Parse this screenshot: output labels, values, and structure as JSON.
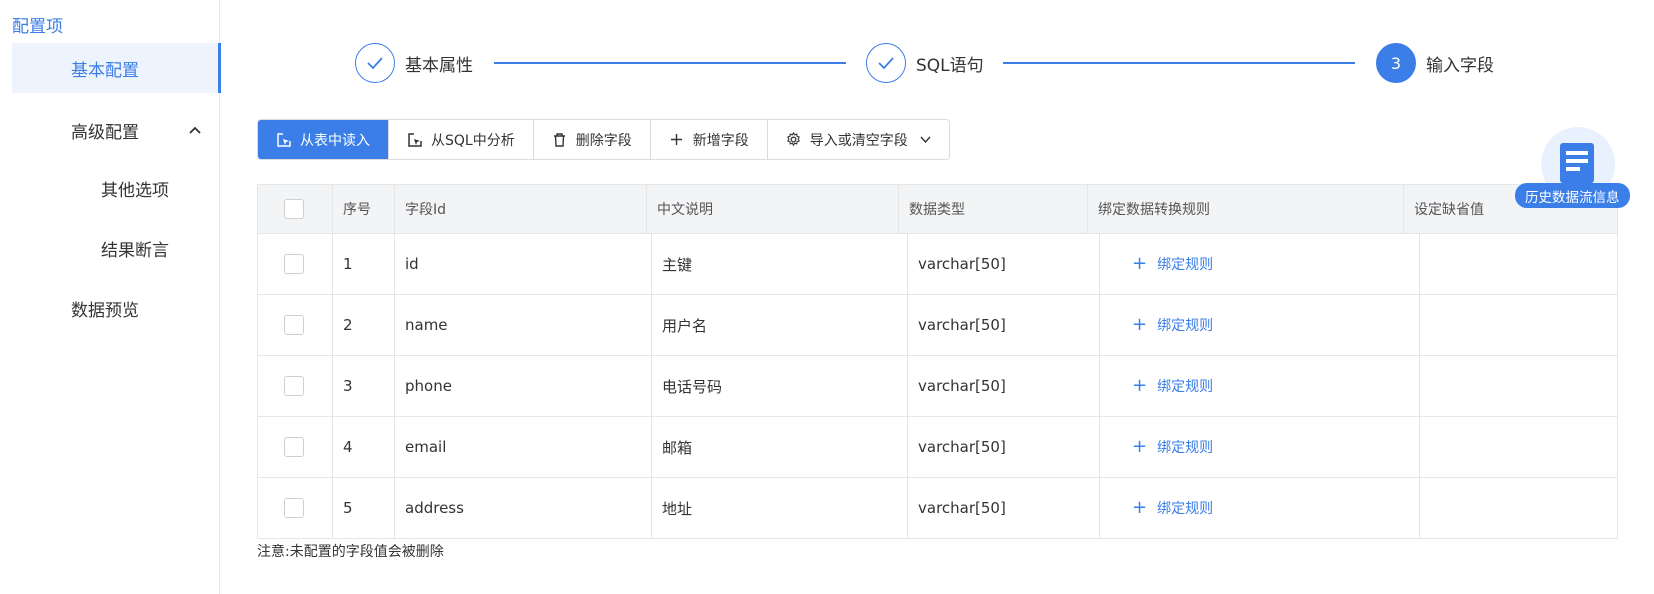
{
  "page": {
    "title": "配置项"
  },
  "sidebar": {
    "basic": "基本配置",
    "advanced": "高级配置",
    "other_options": "其他选项",
    "result_assert": "结果断言",
    "data_preview": "数据预览"
  },
  "steps": [
    {
      "label": "基本属性",
      "state": "done"
    },
    {
      "label": "SQL语句",
      "state": "done"
    },
    {
      "label": "输入字段",
      "state": "active",
      "number": "3"
    }
  ],
  "toolbar": {
    "read_from_table": "从表中读入",
    "analyze_sql": "从SQL中分析",
    "delete_field": "删除字段",
    "add_field": "新增字段",
    "import_clear": "导入或清空字段"
  },
  "table": {
    "headers": [
      "序号",
      "字段Id",
      "中文说明",
      "数据类型",
      "绑定数据转换规则",
      "设定缺省值"
    ],
    "rows": [
      {
        "idx": "1",
        "field_id": "id",
        "desc": "主键",
        "type": "varchar[50]",
        "rule": "绑定规则",
        "default": ""
      },
      {
        "idx": "2",
        "field_id": "name",
        "desc": "用户名",
        "type": "varchar[50]",
        "rule": "绑定规则",
        "default": ""
      },
      {
        "idx": "3",
        "field_id": "phone",
        "desc": "电话号码",
        "type": "varchar[50]",
        "rule": "绑定规则",
        "default": ""
      },
      {
        "idx": "4",
        "field_id": "email",
        "desc": "邮箱",
        "type": "varchar[50]",
        "rule": "绑定规则",
        "default": ""
      },
      {
        "idx": "5",
        "field_id": "address",
        "desc": "地址",
        "type": "varchar[50]",
        "rule": "绑定规则",
        "default": ""
      }
    ]
  },
  "note": "注意:未配置的字段值会被删除",
  "floating": {
    "label": "历史数据流信息",
    "icon": "document-icon"
  },
  "colors": {
    "accent": "#3b7ee8",
    "header_bg": "#f3f4f6",
    "active_bg": "#eef4fd"
  }
}
